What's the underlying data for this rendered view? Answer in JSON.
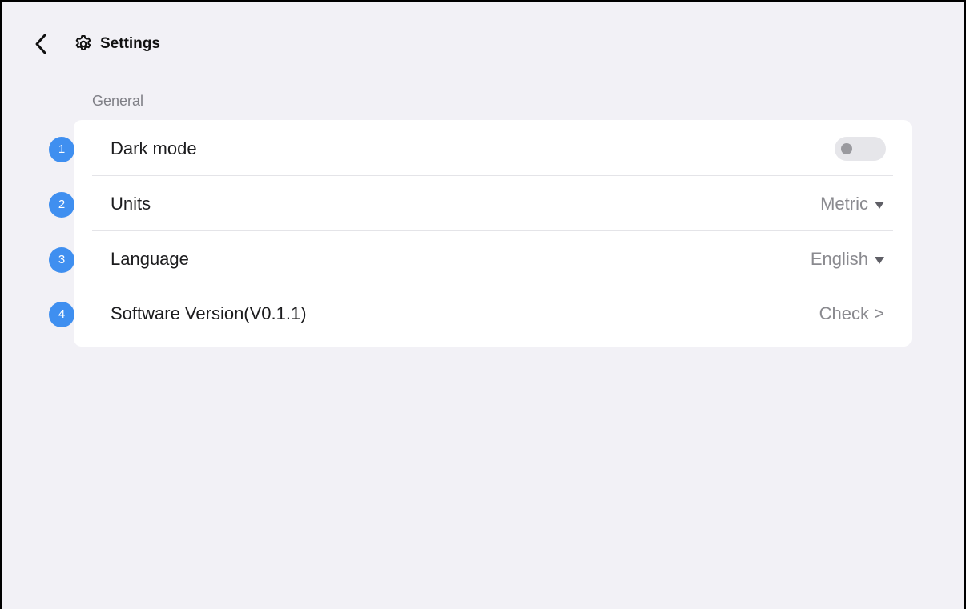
{
  "header": {
    "title": "Settings",
    "back_icon": "chevron-left-icon",
    "title_icon": "gear-icon"
  },
  "section": {
    "label": "General"
  },
  "settings": [
    {
      "badge": "1",
      "label": "Dark mode",
      "control": "toggle",
      "enabled": false
    },
    {
      "badge": "2",
      "label": "Units",
      "value": "Metric",
      "control": "dropdown"
    },
    {
      "badge": "3",
      "label": "Language",
      "value": "English",
      "control": "dropdown"
    },
    {
      "badge": "4",
      "label": "Software Version(V0.1.1)",
      "value": "Check >",
      "control": "link"
    }
  ],
  "colors": {
    "background": "#f2f1f6",
    "card": "#ffffff",
    "badge": "#3f8ff0",
    "muted_text": "#8a8a8f"
  }
}
